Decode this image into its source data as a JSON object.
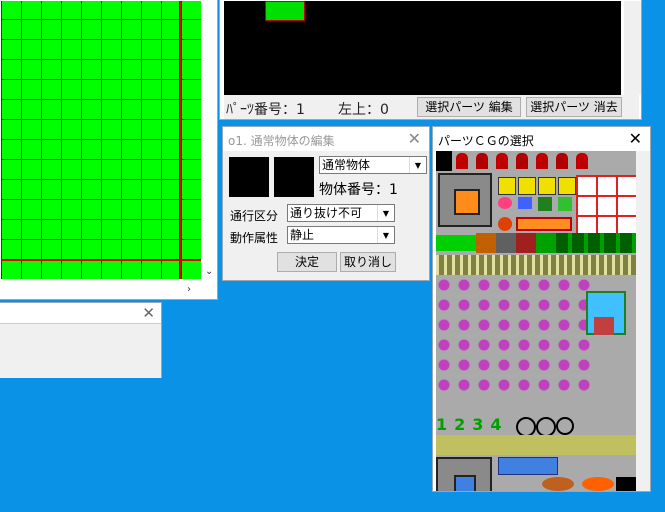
{
  "colors": {
    "desktop": "#0a93e6",
    "map_bg": "#00ff00",
    "grid": "#2424c8",
    "highlight": "#e00000"
  },
  "map_window": {
    "scroll_down_icon": "chevron-down-icon",
    "scroll_right_icon": "chevron-right-icon"
  },
  "top_window": {
    "parts_number_label": "ﾊﾟｰﾂ番号：1",
    "position_label": "左上：0",
    "edit_parts_button": "選択パーツ 編集",
    "delete_parts_button": "選択パーツ 消去"
  },
  "edit_dialog": {
    "title": "o1. 通常物体の編集",
    "object_type": "通常物体",
    "object_number": "物体番号：1",
    "passage_label": "通行区分",
    "passage_value": "通り抜け不可",
    "motion_label": "動作属性",
    "motion_value": "静止",
    "ok_button": "決定",
    "cancel_button": "取り消し"
  },
  "parts_window": {
    "title": "パーツＣＧの選択"
  }
}
